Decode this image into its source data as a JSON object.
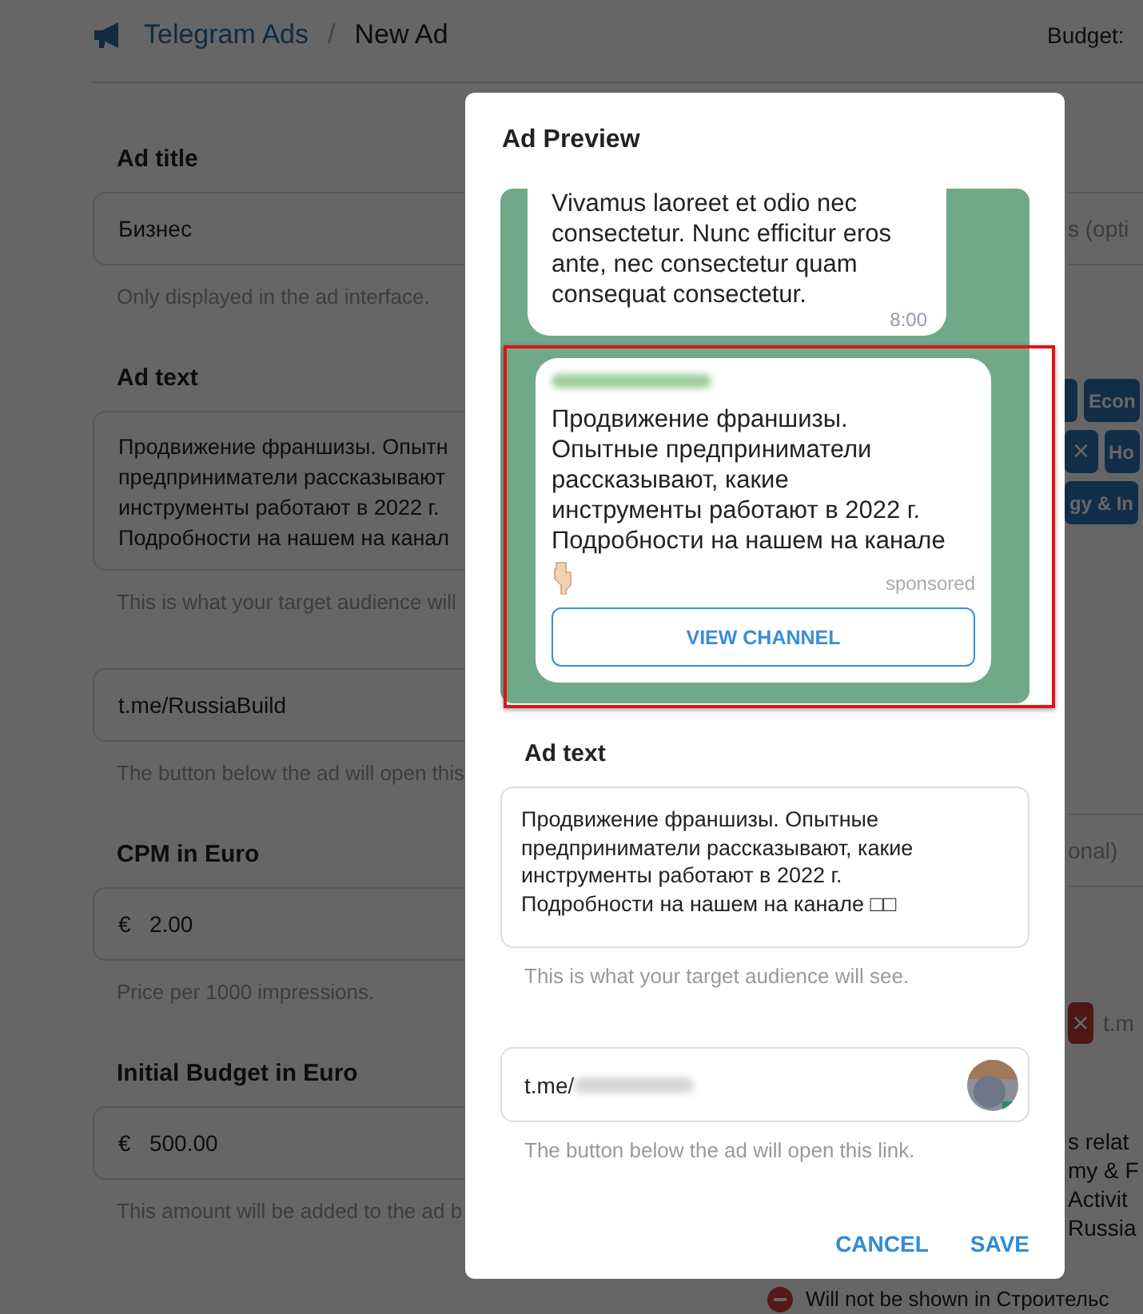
{
  "header": {
    "breadcrumb": [
      {
        "label": "Telegram Ads",
        "kind": "link"
      },
      {
        "label": "New Ad",
        "kind": "current"
      }
    ],
    "separator": "/",
    "budget_label": "Budget:"
  },
  "form": {
    "fields": [
      {
        "kind": "input",
        "label": "Ad title",
        "value": "Бизнес",
        "hint": "Only displayed in the ad interface."
      },
      {
        "kind": "textarea",
        "label": "Ad text",
        "lines": [
          "Продвижение франшизы. Опытн",
          "предприниматели рассказывают",
          "инструменты работают в 2022 г.",
          "Подробности на нашем на канал"
        ],
        "hint": "This is what your target audience will"
      },
      {
        "kind": "input",
        "value": "t.me/RussiaBuild",
        "hint": "The button below the ad will open this"
      },
      {
        "kind": "currency",
        "label": "CPM in Euro",
        "prefix": "€",
        "value": "2.00",
        "hint": "Price per 1000 impressions."
      },
      {
        "kind": "currency",
        "label": "Initial Budget in Euro",
        "prefix": "€",
        "value": "500.00",
        "hint": "This amount will be added to the ad b"
      }
    ]
  },
  "right_panel": {
    "items": [
      {
        "kind": "placeholder",
        "text": "s (opti"
      },
      {
        "kind": "tags",
        "rows": [
          {
            "tags": [
              {
                "kind": "stub"
              },
              {
                "kind": "tag",
                "label": "Econ"
              }
            ]
          },
          {
            "tags": [
              {
                "kind": "remove",
                "label": "×"
              },
              {
                "kind": "tag",
                "label": "Ho"
              }
            ]
          },
          {
            "tags": [
              {
                "kind": "tag",
                "label": "gy & In"
              }
            ]
          }
        ]
      },
      {
        "kind": "placeholder",
        "text": "onal)"
      },
      {
        "kind": "link",
        "remove": "×",
        "text": "t.m"
      },
      {
        "kind": "lines",
        "lines": [
          "s relat",
          "my & F",
          "Activit",
          "Russia"
        ]
      },
      {
        "kind": "notice",
        "text": "Will not be shown in Строительс"
      }
    ]
  },
  "modal": {
    "title": "Ad Preview",
    "highlighted": true,
    "messages": [
      {
        "kind": "post",
        "lines": [
          "Vivamus laoreet et odio nec",
          "consectetur. Nunc efficitur eros",
          "ante, nec consectetur quam",
          "consequat consectetur."
        ],
        "time": "8:00"
      },
      {
        "kind": "ad",
        "lines": [
          "Продвижение франшизы.",
          "Опытные предприниматели",
          "рассказывают, какие",
          "инструменты работают в 2022 г.",
          "Подробности на нашем на канале"
        ],
        "badge": "sponsored",
        "button": "VIEW CHANNEL"
      }
    ],
    "ad_text": {
      "label": "Ad text",
      "lines": [
        "Продвижение франшизы. Опытные",
        "предприниматели рассказывают, какие",
        "инструменты работают в 2022 г.",
        "Подробности на нашем на канале □□"
      ],
      "hint": "This is what your target audience will see."
    },
    "link": {
      "value": "t.me/",
      "hint": "The button below the ad will open this link."
    },
    "buttons": [
      {
        "label": "CANCEL"
      },
      {
        "label": "SAVE"
      }
    ]
  }
}
